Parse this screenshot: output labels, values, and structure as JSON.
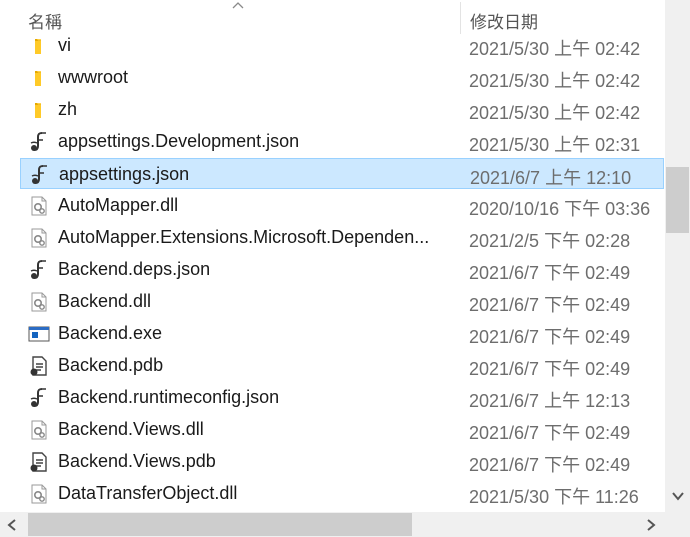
{
  "header": {
    "name_label": "名稱",
    "date_label": "修改日期"
  },
  "files": [
    {
      "name": "vi",
      "date": "2021/5/30 上午 02:42",
      "icon": "folder-icon",
      "selected": false
    },
    {
      "name": "wwwroot",
      "date": "2021/5/30 上午 02:42",
      "icon": "folder-icon",
      "selected": false
    },
    {
      "name": "zh",
      "date": "2021/5/30 上午 02:42",
      "icon": "folder-icon",
      "selected": false
    },
    {
      "name": "appsettings.Development.json",
      "date": "2021/5/30 上午 02:31",
      "icon": "json-file-icon",
      "selected": false
    },
    {
      "name": "appsettings.json",
      "date": "2021/6/7 上午 12:10",
      "icon": "json-file-icon",
      "selected": true
    },
    {
      "name": "AutoMapper.dll",
      "date": "2020/10/16 下午 03:36",
      "icon": "dll-file-icon",
      "selected": false
    },
    {
      "name": "AutoMapper.Extensions.Microsoft.Dependen...",
      "date": "2021/2/5 下午 02:28",
      "icon": "dll-file-icon",
      "selected": false
    },
    {
      "name": "Backend.deps.json",
      "date": "2021/6/7 下午 02:49",
      "icon": "json-file-icon",
      "selected": false
    },
    {
      "name": "Backend.dll",
      "date": "2021/6/7 下午 02:49",
      "icon": "dll-file-icon",
      "selected": false
    },
    {
      "name": "Backend.exe",
      "date": "2021/6/7 下午 02:49",
      "icon": "exe-file-icon",
      "selected": false
    },
    {
      "name": "Backend.pdb",
      "date": "2021/6/7 下午 02:49",
      "icon": "pdb-file-icon",
      "selected": false
    },
    {
      "name": "Backend.runtimeconfig.json",
      "date": "2021/6/7 上午 12:13",
      "icon": "json-file-icon",
      "selected": false
    },
    {
      "name": "Backend.Views.dll",
      "date": "2021/6/7 下午 02:49",
      "icon": "dll-file-icon",
      "selected": false
    },
    {
      "name": "Backend.Views.pdb",
      "date": "2021/6/7 下午 02:49",
      "icon": "pdb-file-icon",
      "selected": false
    },
    {
      "name": "DataTransferObject.dll",
      "date": "2021/5/30 下午 11:26",
      "icon": "dll-file-icon",
      "selected": false
    }
  ],
  "colors": {
    "selection_bg": "#cce8ff",
    "selection_border": "#99d1ff",
    "folder": "#ffca28",
    "date_text": "#6d6d6d"
  }
}
